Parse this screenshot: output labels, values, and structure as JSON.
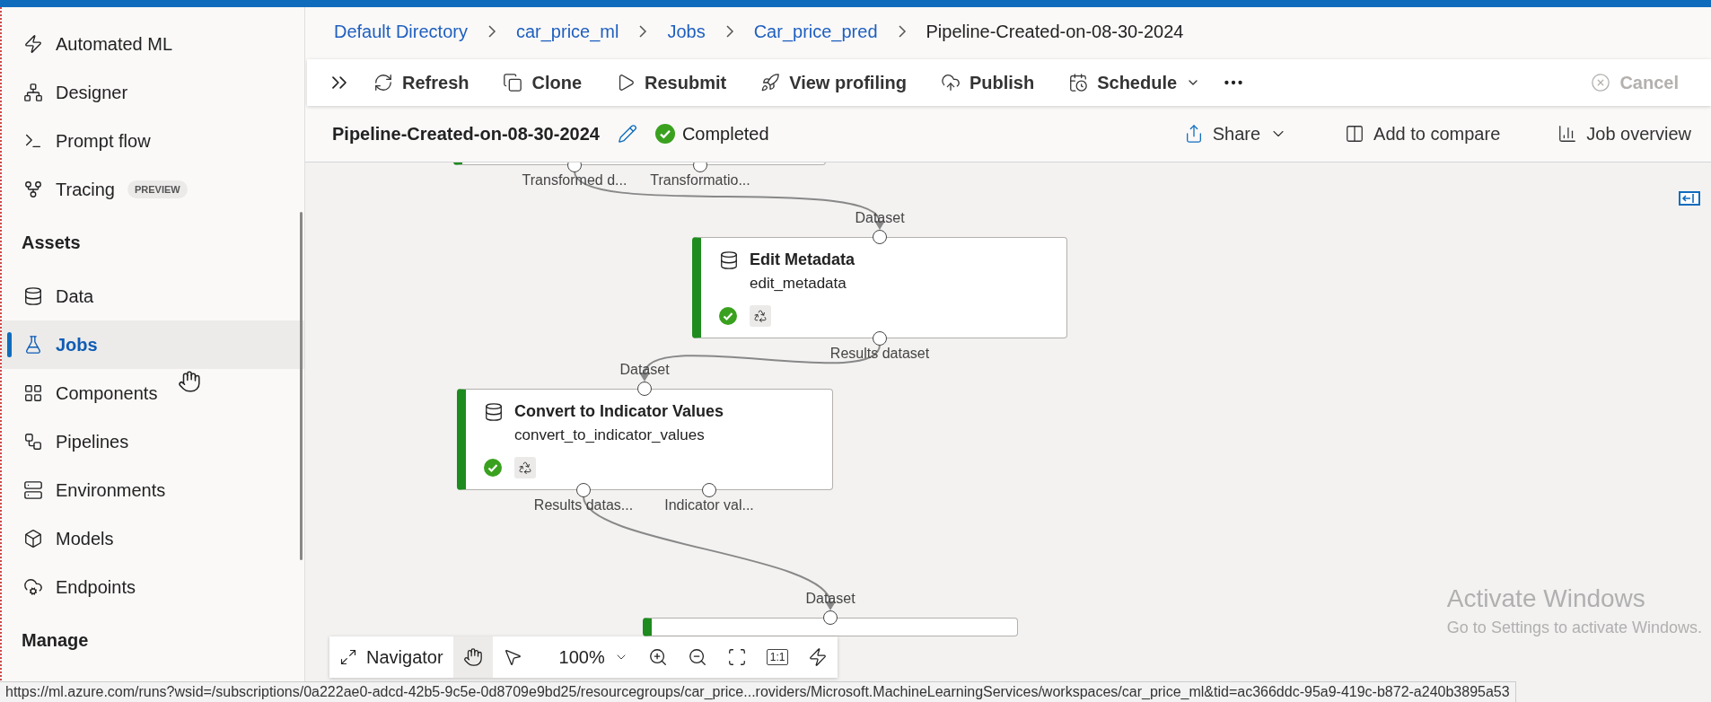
{
  "sidebar": {
    "items": [
      {
        "kind": "item",
        "label": "Automated ML",
        "selected": false
      },
      {
        "kind": "item",
        "label": "Designer",
        "selected": false
      },
      {
        "kind": "item",
        "label": "Prompt flow",
        "selected": false
      },
      {
        "kind": "item",
        "label": "Tracing",
        "badge": "PREVIEW",
        "selected": false
      },
      {
        "kind": "heading",
        "label": "Assets"
      },
      {
        "kind": "item",
        "label": "Data",
        "selected": false
      },
      {
        "kind": "item",
        "label": "Jobs",
        "selected": true
      },
      {
        "kind": "item",
        "label": "Components",
        "selected": false
      },
      {
        "kind": "item",
        "label": "Pipelines",
        "selected": false
      },
      {
        "kind": "item",
        "label": "Environments",
        "selected": false
      },
      {
        "kind": "item",
        "label": "Models",
        "selected": false
      },
      {
        "kind": "item",
        "label": "Endpoints",
        "selected": false
      },
      {
        "kind": "heading",
        "label": "Manage"
      }
    ]
  },
  "breadcrumb": [
    {
      "label": "Default Directory",
      "current": false
    },
    {
      "label": "car_price_ml",
      "current": false
    },
    {
      "label": "Jobs",
      "current": false
    },
    {
      "label": "Car_price_pred",
      "current": false
    },
    {
      "label": "Pipeline-Created-on-08-30-2024",
      "current": true
    }
  ],
  "toolbar": [
    {
      "label": "Refresh",
      "disabled": false
    },
    {
      "label": "Clone",
      "disabled": false
    },
    {
      "label": "Resubmit",
      "disabled": false
    },
    {
      "label": "View profiling",
      "disabled": false
    },
    {
      "label": "Publish",
      "disabled": false
    },
    {
      "label": "Schedule",
      "disabled": false,
      "dropdown": true
    },
    {
      "label": "Cancel",
      "disabled": true
    }
  ],
  "job": {
    "title": "Pipeline-Created-on-08-30-2024",
    "status": "Completed"
  },
  "actions": [
    {
      "label": "Share",
      "dropdown": true
    },
    {
      "label": "Add to compare"
    },
    {
      "label": "Job overview"
    }
  ],
  "nodes": [
    {
      "outputs": [
        "Transformed d...",
        "Transformatio..."
      ]
    },
    {
      "title": "Edit Metadata",
      "name": "edit_metadata",
      "completed": true,
      "inputs": [
        "Dataset"
      ],
      "outputs": [
        "Results dataset"
      ]
    },
    {
      "title": "Convert to Indicator Values",
      "name": "convert_to_indicator_values",
      "completed": true,
      "inputs": [
        "Dataset"
      ],
      "outputs": [
        "Results datas...",
        "Indicator val..."
      ]
    },
    {
      "inputs": [
        "Dataset"
      ]
    }
  ],
  "navigator": {
    "label": "Navigator",
    "zoom": "100%",
    "actual_size": "1:1"
  },
  "activation": {
    "title": "Activate Windows",
    "subtitle": "Go to Settings to activate Windows."
  },
  "status_bar": {
    "url": "https://ml.azure.com/runs?wsid=/subscriptions/0a222ae0-adcd-42b5-9c5e-0d8709e9bd25/resourcegroups/car_price...roviders/Microsoft.MachineLearningServices/workspaces/car_price_ml&tid=ac366ddc-95a9-419c-b872-a240b3895a53"
  }
}
